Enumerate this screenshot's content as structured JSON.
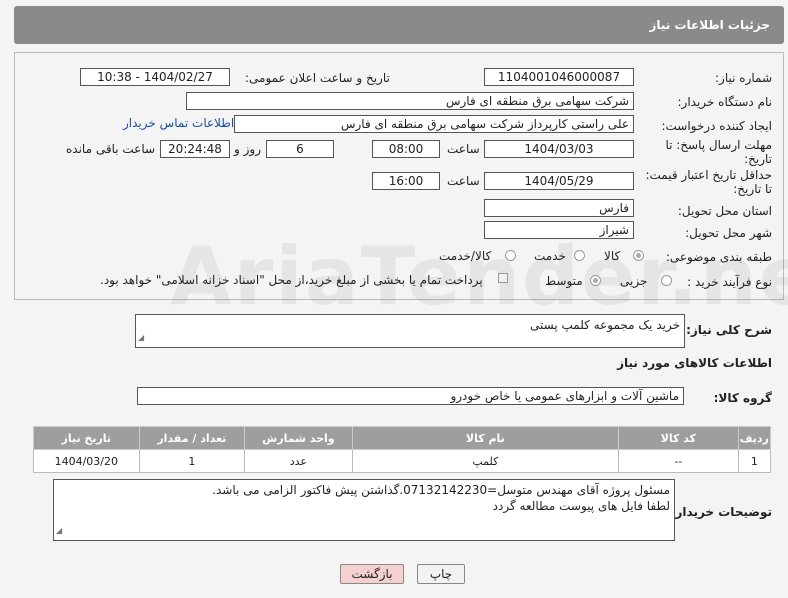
{
  "header": {
    "title": "جزئیات اطلاعات نیاز"
  },
  "form": {
    "need_number_label": "شماره نیاز:",
    "need_number": "1104001046000087",
    "announce_label": "تاریخ و ساعت اعلان عمومی:",
    "announce_value": "1404/02/27 - 10:38",
    "buyer_org_label": "نام دستگاه خریدار:",
    "buyer_org": "شرکت سهامی برق منطقه ای فارس",
    "creator_label": "ایجاد کننده درخواست:",
    "creator": "علی راستی کارپرداز شرکت سهامی برق منطقه ای فارس",
    "contact_link": "اطلاعات تماس خریدار",
    "deadline_label_1": "مهلت ارسال پاسخ: تا",
    "deadline_label_2": "تاریخ:",
    "deadline_date": "1404/03/03",
    "time_label": "ساعت",
    "deadline_time": "08:00",
    "days_value": "6",
    "days_label": "روز و",
    "remaining_time": "20:24:48",
    "remaining_label": "ساعت باقی مانده",
    "validity_label_1": "حداقل تاریخ اعتبار قیمت:",
    "validity_label_2": "تا تاریخ:",
    "validity_date": "1404/05/29",
    "validity_time": "16:00",
    "province_label": "استان محل تحویل:",
    "province": "فارس",
    "city_label": "شهر محل تحویل:",
    "city": "شیراز",
    "category_label": "طبقه بندی موضوعی:",
    "category_options": [
      "کالا",
      "خدمت",
      "کالا/خدمت"
    ],
    "process_label": "نوع فرآیند خرید :",
    "process_options": [
      "جزیی",
      "متوسط"
    ],
    "payment_note": "پرداخت تمام یا بخشی از مبلغ خرید،از محل \"اسناد خزانه اسلامی\" خواهد بود."
  },
  "description": {
    "label": "شرح کلی نیاز:",
    "value": "خرید یک مجموعه کلمپ پستی"
  },
  "goods": {
    "section_title": "اطلاعات کالاهای مورد نیاز",
    "group_label": "گروه کالا:",
    "group_value": "ماشین آلات و ابزارهای عمومی یا خاص خودرو",
    "columns": [
      "ردیف",
      "کد کالا",
      "نام کالا",
      "واحد شمارش",
      "تعداد / مقدار",
      "تاریخ نیاز"
    ],
    "rows": [
      [
        "1",
        "--",
        "کلمپ",
        "عدد",
        "1",
        "1404/03/20"
      ]
    ]
  },
  "notes": {
    "label": "توضیحات خریدار:",
    "line1": "مسئول پروژه آقای مهندس متوسل=07132142230.گذاشتن پیش فاکتور الزامی می باشد.",
    "line2": "لطفا فایل های پیوست مطالعه گردد"
  },
  "buttons": {
    "print": "چاپ",
    "back": "بازگشت"
  },
  "watermark": "AriaTender.neT"
}
